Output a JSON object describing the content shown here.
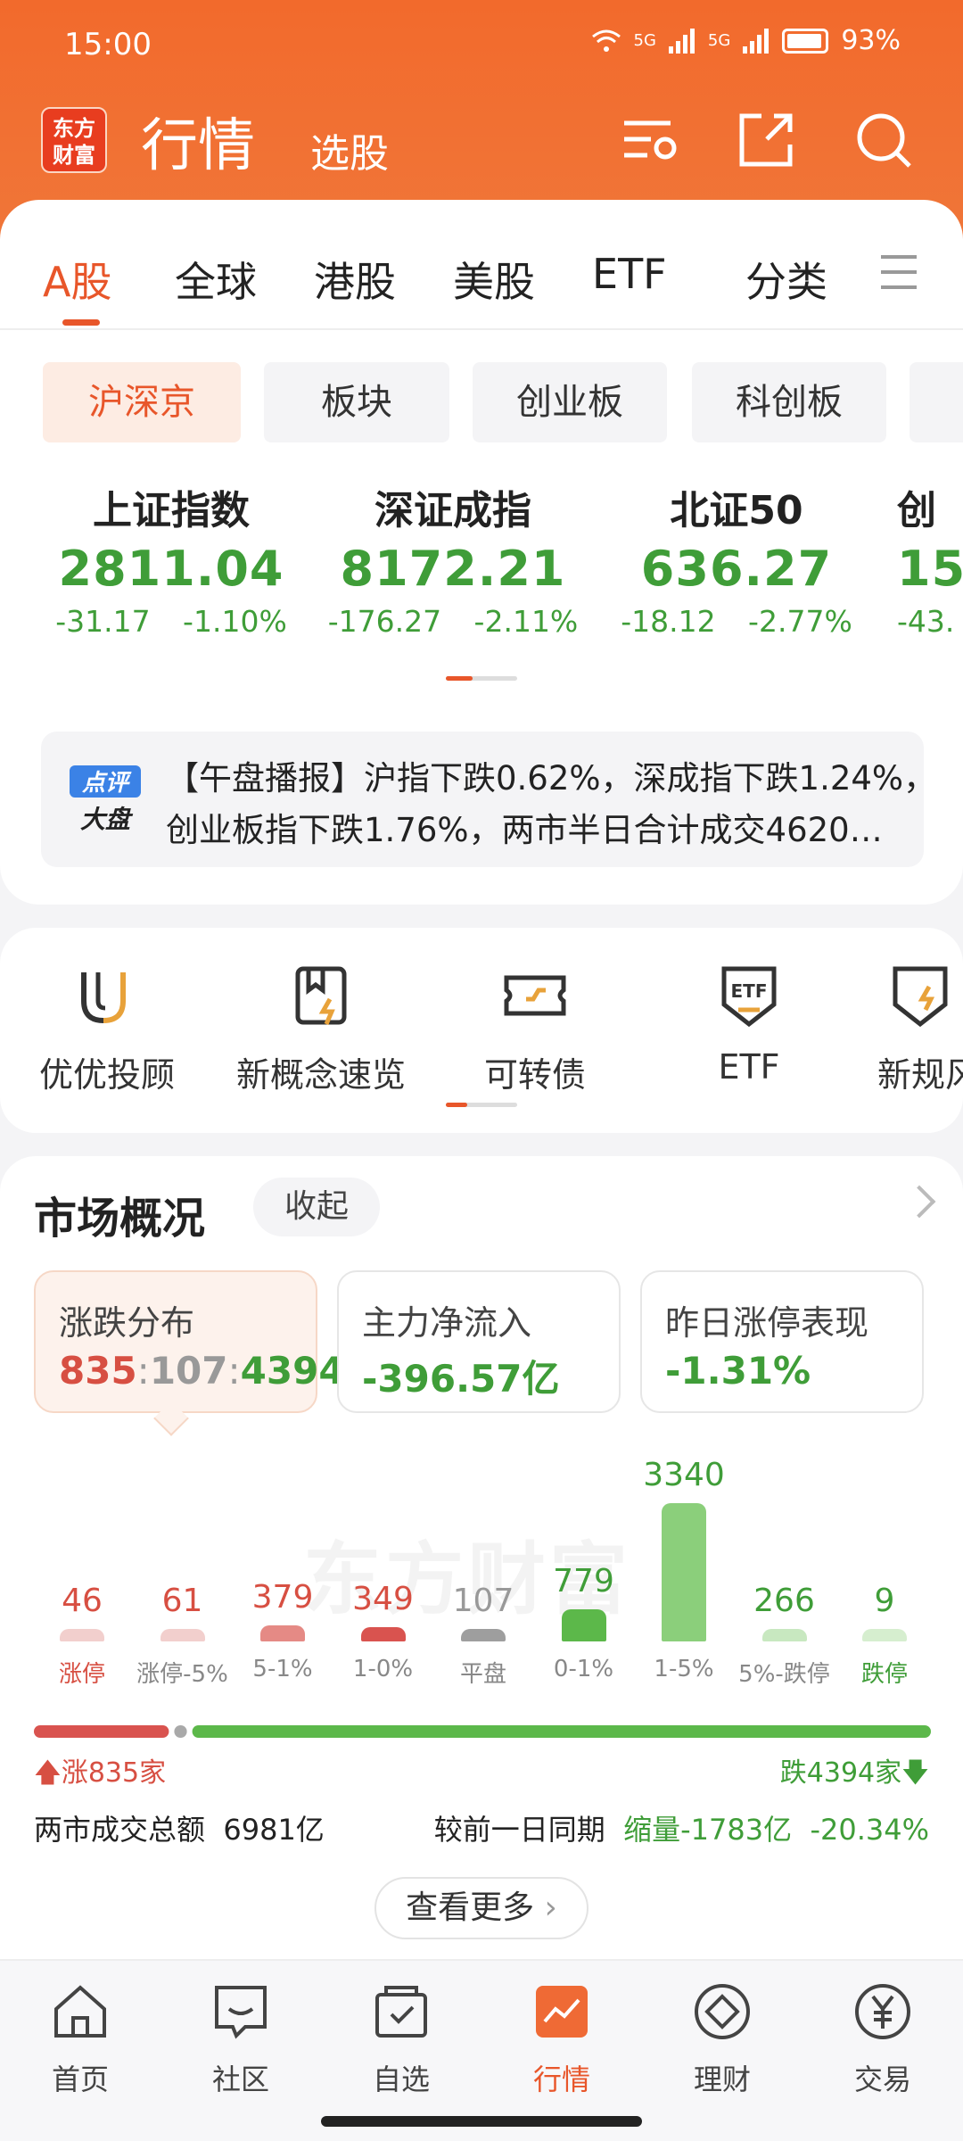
{
  "status": {
    "time": "15:00",
    "net1": "5G",
    "net2": "5G",
    "battery": "93%"
  },
  "header": {
    "logo": "东方财富",
    "title": "行情",
    "subtitle": "选股"
  },
  "tabs": [
    {
      "label": "A股",
      "active": true
    },
    {
      "label": "全球"
    },
    {
      "label": "港股"
    },
    {
      "label": "美股"
    },
    {
      "label": "ETF"
    },
    {
      "label": "分类"
    }
  ],
  "chips": [
    {
      "label": "沪深京",
      "active": true
    },
    {
      "label": "板块"
    },
    {
      "label": "创业板"
    },
    {
      "label": "科创板"
    }
  ],
  "indices": [
    {
      "name": "上证指数",
      "value": "2811.04",
      "change": "-31.17 -1.10%"
    },
    {
      "name": "深证成指",
      "value": "8172.21",
      "change": "-176.27 -2.11%"
    },
    {
      "name": "北证50",
      "value": "636.27",
      "change": "-18.12 -2.77%"
    },
    {
      "name": "创",
      "value": "15",
      "change": "-43."
    }
  ],
  "news": {
    "badge_top": "点评",
    "badge_bottom": "大盘",
    "line1": "【午盘播报】沪指下跌0.62%，深成指下跌1.24%，",
    "line2": "创业板指下跌1.76%，两市半日合计成交4620…"
  },
  "tools": [
    {
      "label": "优优投顾",
      "icon": "uu-icon"
    },
    {
      "label": "新概念速览",
      "icon": "bookmark-bolt-icon"
    },
    {
      "label": "可转债",
      "icon": "ticket-icon"
    },
    {
      "label": "ETF",
      "icon": "etf-shield-icon"
    },
    {
      "label": "新规风",
      "icon": "shield-icon"
    }
  ],
  "market": {
    "title": "市场概况",
    "collapse": "收起",
    "stats": [
      {
        "label": "涨跌分布",
        "value_up": "835",
        "sep1": ":",
        "value_flat": "107",
        "sep2": ":",
        "value_down": "4394"
      },
      {
        "label": "主力净流入",
        "value": "-396.57亿"
      },
      {
        "label": "昨日涨停表现",
        "value": "-1.31%"
      }
    ],
    "watermark": "东方财富",
    "up_label": "涨835家",
    "down_label": "跌4394家",
    "volume_label": "两市成交总额",
    "volume_value": "6981亿",
    "compare_label": "较前一日同期",
    "compare_value": "缩量-1783亿",
    "compare_pct": "-20.34%",
    "more": "查看更多"
  },
  "chart_data": {
    "type": "bar",
    "categories": [
      "涨停",
      "涨停-5%",
      "5-1%",
      "1-0%",
      "平盘",
      "0-1%",
      "1-5%",
      "5%-跌停",
      "跌停"
    ],
    "values": [
      46,
      61,
      379,
      349,
      107,
      779,
      3340,
      266,
      9
    ],
    "colors": [
      "#f2cfcd",
      "#f2cfcd",
      "#e58a85",
      "#d9534f",
      "#9e9e9e",
      "#5cb84a",
      "#8bcf7b",
      "#c8e8c0",
      "#d6eecf"
    ],
    "label_colors": [
      "#d74f42",
      "#d74f42",
      "#d74f42",
      "#d74f42",
      "#999999",
      "#3f9d38",
      "#3f9d38",
      "#3f9d38",
      "#3f9d38"
    ],
    "ratio": {
      "up": 835,
      "flat": 107,
      "down": 4394
    }
  },
  "nav": [
    {
      "label": "首页",
      "icon": "home-icon"
    },
    {
      "label": "社区",
      "icon": "chat-icon"
    },
    {
      "label": "自选",
      "icon": "bag-check-icon"
    },
    {
      "label": "行情",
      "icon": "chart-icon",
      "active": true
    },
    {
      "label": "理财",
      "icon": "diamond-icon"
    },
    {
      "label": "交易",
      "icon": "yen-icon"
    }
  ]
}
